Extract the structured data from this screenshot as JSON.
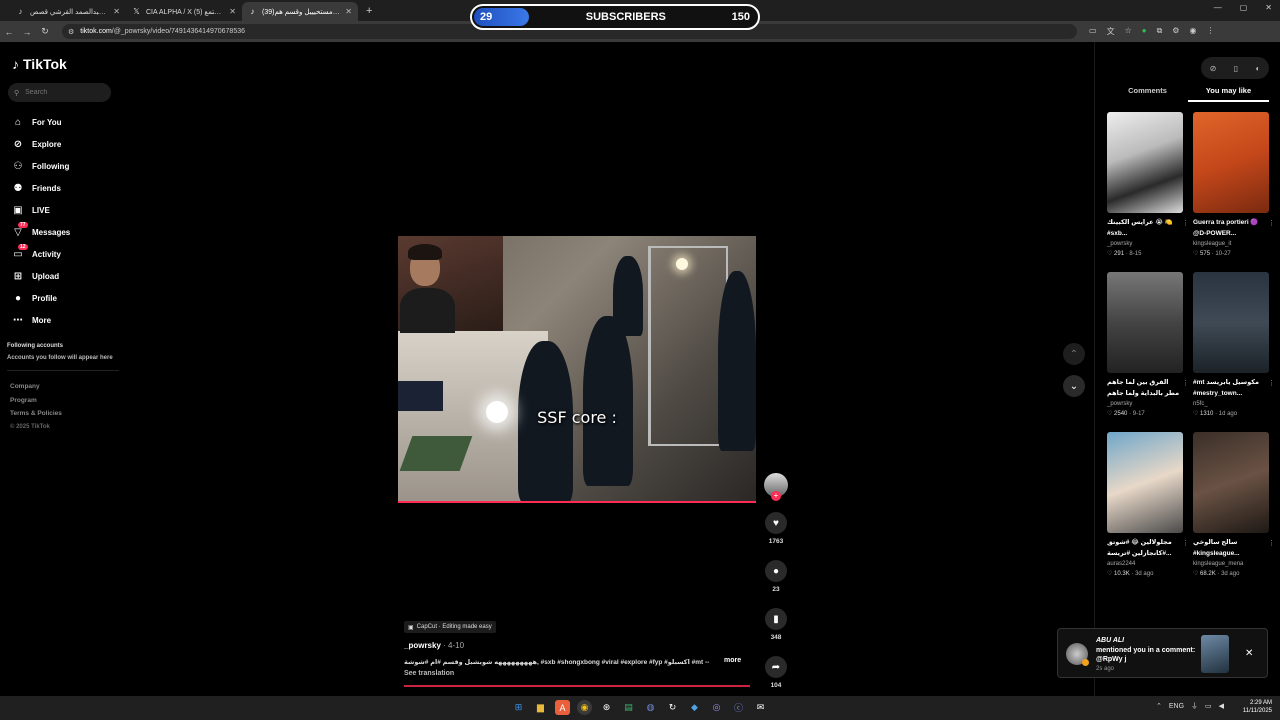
{
  "browser": {
    "tabs": [
      {
        "title": "القادح عبدالصمد القرشي قصص",
        "icon": "tiktok-icon",
        "active": false
      },
      {
        "title": "CIA ALPHA / X (5) المجتمع",
        "icon": "x-logo-icon",
        "active": false
      },
      {
        "title": "(39)ق مستحيييل وقسم هم...",
        "icon": "tiktok-icon",
        "active": true
      }
    ],
    "new_tab": "+",
    "window_controls": [
      "—",
      "▢",
      "✕"
    ],
    "url_domain": "tiktok.com",
    "url_path": "/@_powrsky/video/7491436414970678536"
  },
  "subscribers": {
    "current": "29",
    "label": "SUBSCRIBERS",
    "goal": "150",
    "progress": 0.193
  },
  "sidebar": {
    "logo": "TikTok",
    "search_placeholder": "Search",
    "nav": [
      {
        "label": "For You",
        "icon": "home-icon",
        "glyph": "⌂"
      },
      {
        "label": "Explore",
        "icon": "compass-icon",
        "glyph": "⊘"
      },
      {
        "label": "Following",
        "icon": "following-icon",
        "glyph": "⚇"
      },
      {
        "label": "Friends",
        "icon": "friends-icon",
        "glyph": "⚉"
      },
      {
        "label": "LIVE",
        "icon": "live-icon",
        "glyph": "▣"
      },
      {
        "label": "Messages",
        "icon": "messages-icon",
        "glyph": "▽",
        "badge": "77"
      },
      {
        "label": "Activity",
        "icon": "activity-icon",
        "glyph": "▭",
        "badge": "12"
      },
      {
        "label": "Upload",
        "icon": "upload-icon",
        "glyph": "⊞"
      },
      {
        "label": "Profile",
        "icon": "profile-avatar-icon",
        "glyph": "●"
      },
      {
        "label": "More",
        "icon": "more-icon",
        "glyph": "⋯"
      }
    ],
    "following_header": "Following accounts",
    "following_text": "Accounts you follow will appear here",
    "footer": [
      "Company",
      "Program",
      "Terms & Policies"
    ],
    "copyright": "© 2025 TikTok"
  },
  "video": {
    "caption": "SSF core :",
    "capcut": "CapCut · Editing made easy",
    "author": "_powrsky",
    "date": "4-10",
    "description": "هههههههههه شوبشبل وقسم #ام #شوشة, #sxb #shongxbong #viral #explore #fyp #اكسبلو #mt --",
    "more": "more",
    "see_translation": "See translation"
  },
  "actions": {
    "likes": "1763",
    "comments": "23",
    "saves": "348",
    "shares": "104"
  },
  "right_panel": {
    "tabs": [
      "Comments",
      "You may like"
    ],
    "active_tab": "You may like",
    "cards": [
      {
        "title": "عرايس الكبينك 😭 🍋 #sxb...",
        "author": "_powrsky",
        "likes": "291",
        "date": "8-15"
      },
      {
        "title": "Guerra tra portieri 🟣 @D-POWER...",
        "author": "kingsleague_it",
        "likes": "575",
        "date": "10-27"
      },
      {
        "title": "الفرق بين لما جاهم مطر بالبداية ولما جاهم مطر...",
        "author": "_powrsky",
        "likes": "2540",
        "date": "9-17"
      },
      {
        "title": "#mt مكوسيل يابريسد #mestry_town...",
        "author": "n5fc_",
        "likes": "1310",
        "date": "1d ago"
      },
      {
        "title": "مجلولالين 😂 #شوتق #كانجازلين #تريسة...",
        "author": "auras2244",
        "likes": "10.3K",
        "date": "3d ago"
      },
      {
        "title": "سالح سالوخي #kingsleague...",
        "author": "kingsleague_mena",
        "likes": "68.2K",
        "date": "3d ago"
      }
    ]
  },
  "notification": {
    "name": "ABU ALI",
    "message": "mentioned you in a comment: @RpWy j",
    "time": "2s ago"
  },
  "taskbar": {
    "lang": "ENG",
    "time": "2:29 AM",
    "date": "11/11/2025"
  }
}
